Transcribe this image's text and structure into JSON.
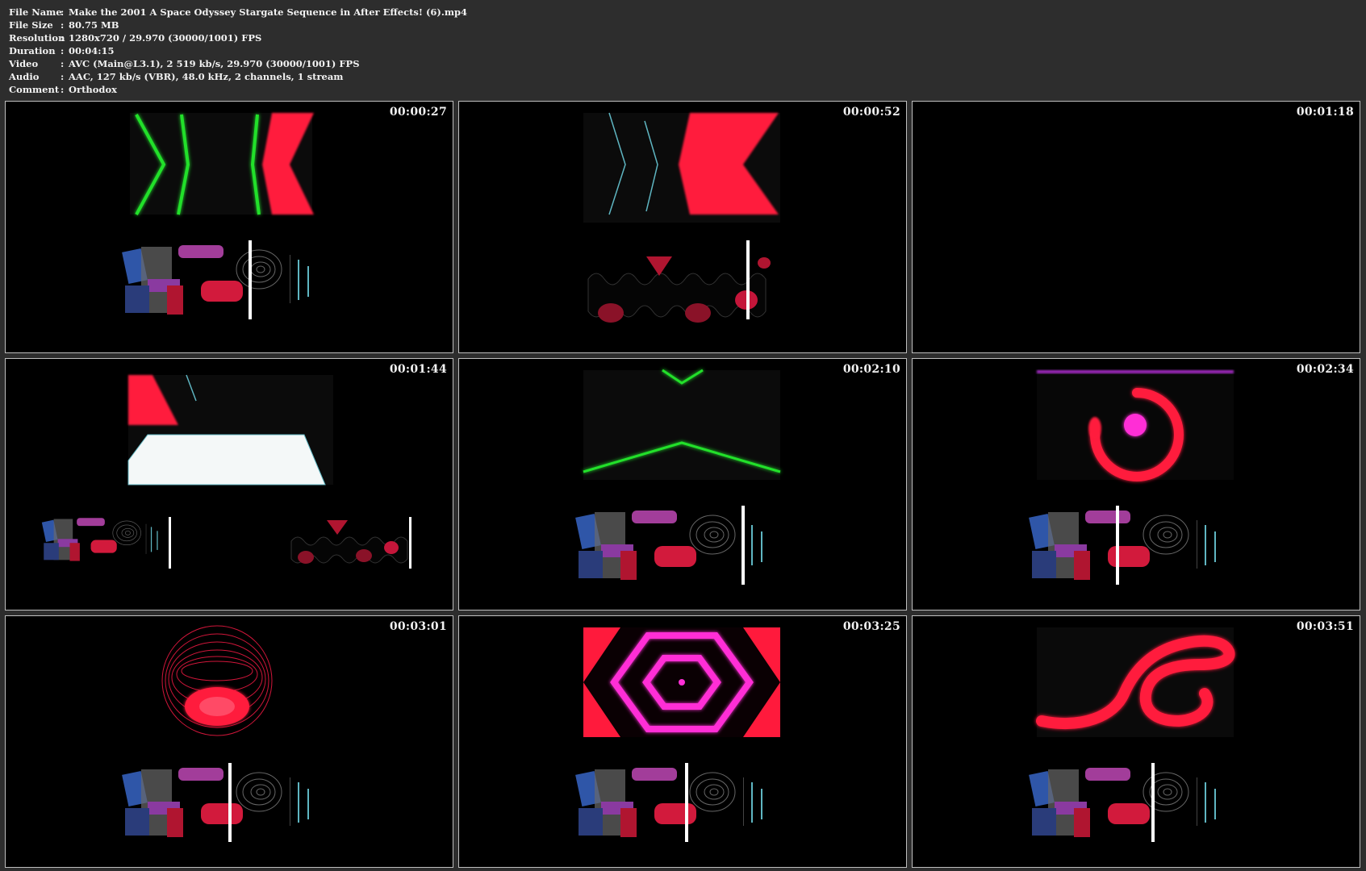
{
  "metadata": [
    {
      "label": "File Name",
      "value": "Make the 2001 A Space Odyssey Stargate Sequence in After Effects! (6).mp4"
    },
    {
      "label": "File Size",
      "value": "80.75 MB"
    },
    {
      "label": "Resolution",
      "value": "1280x720 / 29.970 (30000/1001) FPS"
    },
    {
      "label": "Duration",
      "value": "00:04:15"
    },
    {
      "label": "Video",
      "value": "AVC (Main@L3.1), 2 519 kb/s, 29.970 (30000/1001) FPS"
    },
    {
      "label": "Audio",
      "value": "AAC, 127 kb/s (VBR), 48.0 kHz, 2 channels, 1 stream"
    },
    {
      "label": "Comment",
      "value": "Orthodox"
    }
  ],
  "separator": ":",
  "thumbnails": [
    {
      "timestamp": "00:00:27",
      "content": "green-chevrons-red-band"
    },
    {
      "timestamp": "00:00:52",
      "content": "red-chevron-wave-blobs"
    },
    {
      "timestamp": "00:01:18",
      "content": "black-frame"
    },
    {
      "timestamp": "00:01:44",
      "content": "white-trapezoid-split"
    },
    {
      "timestamp": "00:02:10",
      "content": "green-lines"
    },
    {
      "timestamp": "00:02:34",
      "content": "red-ring-magenta-dot"
    },
    {
      "timestamp": "00:03:01",
      "content": "red-wire-sphere"
    },
    {
      "timestamp": "00:03:25",
      "content": "magenta-hexagon"
    },
    {
      "timestamp": "00:03:51",
      "content": "red-swirl"
    }
  ],
  "colors": {
    "background": "#2d2d2d",
    "text": "#f2f2f2",
    "neon_green": "#22e02a",
    "neon_red": "#ff1a3c",
    "neon_magenta": "#ff2fd6"
  }
}
